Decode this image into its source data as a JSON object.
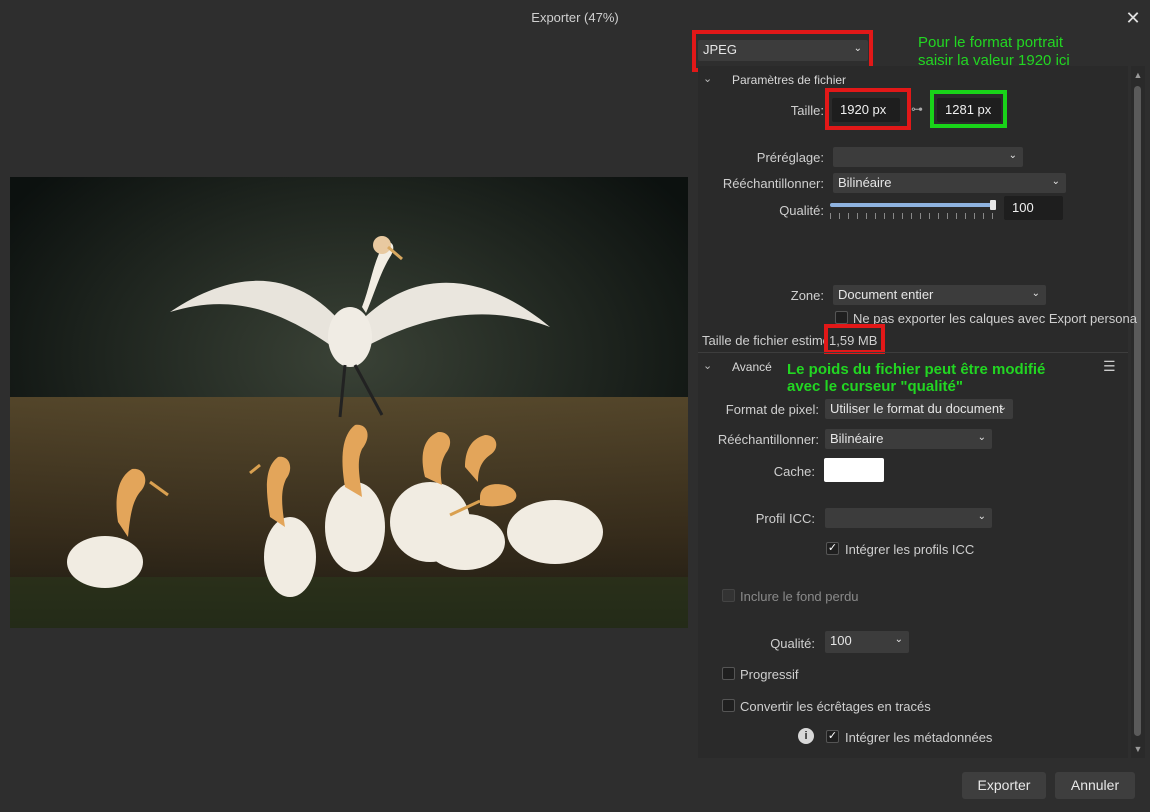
{
  "window": {
    "title": "Exporter (47%)"
  },
  "format_select": {
    "value": "JPEG"
  },
  "annotations": {
    "portrait_line1": "Pour le format portrait",
    "portrait_line2": "saisir la valeur 1920 ici",
    "weight_line1": "Le poids du fichier peut être modifié",
    "weight_line2": "avec le curseur \"qualité\"",
    "color": "#22d622"
  },
  "file_params": {
    "header": "Paramètres de fichier",
    "size_label": "Taille:",
    "width": "1920 px",
    "height": "1281 px",
    "preset_label": "Préréglage:",
    "preset_value": "",
    "resample_label": "Rééchantillonner:",
    "resample_value": "Bilinéaire",
    "quality_label": "Qualité:",
    "quality_value": "100",
    "quality_fraction": 1.0,
    "zone_label": "Zone:",
    "zone_value": "Document entier",
    "no_export_layers": "Ne pas exporter les calques avec Export persona",
    "estimated_label": "Taille de fichier estimée:",
    "estimated_value": "1,59 MB"
  },
  "advanced": {
    "header": "Avancé",
    "pixel_format_label": "Format de pixel:",
    "pixel_format_value": "Utiliser le format du document",
    "resample_label": "Rééchantillonner:",
    "resample_value": "Bilinéaire",
    "cache_label": "Cache:",
    "icc_label": "Profil ICC:",
    "icc_value": "",
    "embed_icc": "Intégrer les profils ICC",
    "include_bleed": "Inclure le fond perdu",
    "quality_label": "Qualité:",
    "quality_value": "100",
    "progressive": "Progressif",
    "convert_clips": "Convertir les écrêtages en tracés",
    "embed_metadata": "Intégrer les métadonnées"
  },
  "buttons": {
    "export": "Exporter",
    "cancel": "Annuler"
  },
  "colors": {
    "highlight_red": "#e21818",
    "highlight_green": "#19d319",
    "accent_blue": "#8fb3e0"
  }
}
